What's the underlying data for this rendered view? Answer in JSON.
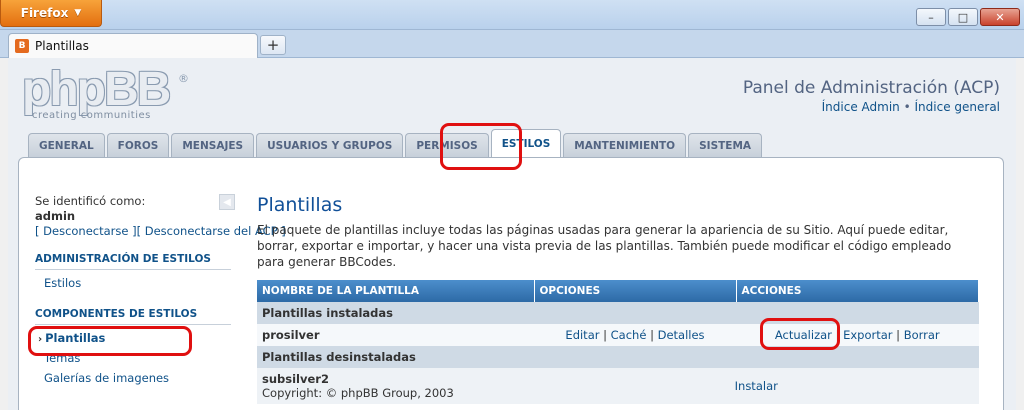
{
  "browser": {
    "menu_button": "Firefox",
    "tab_title": "Plantillas",
    "favicon_letter": "B",
    "new_tab": "+",
    "controls": {
      "minimize": "–",
      "maximize": "□",
      "close": "✕"
    }
  },
  "header": {
    "logo_text": "phpBB",
    "logo_reg": "®",
    "logo_tagline": "creating communities",
    "acp_title": "Panel de Administración (ACP)",
    "link_admin_index": "Índice Admin",
    "link_separator": "•",
    "link_general_index": "Índice general"
  },
  "nav_tabs": [
    {
      "label": "GENERAL"
    },
    {
      "label": "FOROS"
    },
    {
      "label": "MENSAJES"
    },
    {
      "label": "USUARIOS Y GRUPOS"
    },
    {
      "label": "PERMISOS"
    },
    {
      "label": "ESTILOS"
    },
    {
      "label": "MANTENIMIENTO"
    },
    {
      "label": "SISTEMA"
    }
  ],
  "sidebar": {
    "identified_as": "Se identificó como:",
    "username": "admin",
    "logout_link": "[ Desconectarse ][ Desconectarse del ACP ]",
    "collapse_glyph": "◀",
    "sections": [
      {
        "title": "ADMINISTRACIÓN DE ESTILOS",
        "items": [
          "Estilos"
        ]
      },
      {
        "title": "COMPONENTES DE ESTILOS",
        "items": [
          "Plantillas",
          "Temas",
          "Galerías de imagenes"
        ]
      }
    ],
    "active_bullet": "›"
  },
  "main": {
    "title": "Plantillas",
    "description": "El paquete de plantillas incluye todas las páginas usadas para generar la apariencia de su Sitio. Aquí puede editar, borrar, exportar e importar, y hacer una vista previa de las plantillas. También puede modificar el código empleado para generar BBCodes.",
    "table": {
      "headers": [
        "NOMBRE DE LA PLANTILLA",
        "OPCIONES",
        "ACCIONES"
      ],
      "installed_label": "Plantillas instaladas",
      "installed": {
        "name": "prosilver",
        "options": [
          "Editar",
          "Caché",
          "Detalles"
        ],
        "actions": [
          "Actualizar",
          "Exportar",
          "Borrar"
        ]
      },
      "uninstalled_label": "Plantillas desinstaladas",
      "uninstalled": {
        "name": "subsilver2",
        "copyright": "Copyright: © phpBB Group, 2003",
        "action": "Instalar"
      },
      "pipe": "|"
    }
  },
  "colors": {
    "link": "#105289",
    "header_blue": "#2d6aa6",
    "highlight_red": "#e01010",
    "firefox_orange": "#e36f10"
  }
}
